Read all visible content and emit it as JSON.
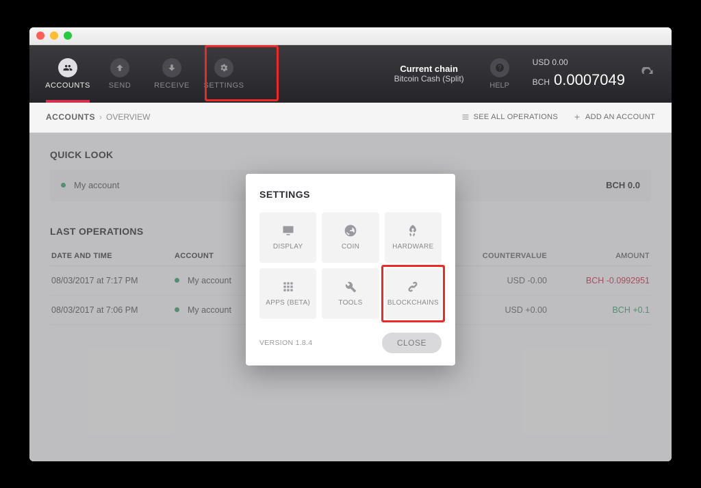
{
  "window": {
    "traffic_lights": [
      "close",
      "minimize",
      "zoom"
    ]
  },
  "header": {
    "nav": [
      {
        "key": "accounts",
        "label": "ACCOUNTS",
        "icon": "users-icon",
        "active": true
      },
      {
        "key": "send",
        "label": "SEND",
        "icon": "arrow-up-icon",
        "active": false
      },
      {
        "key": "receive",
        "label": "RECEIVE",
        "icon": "arrow-down-icon",
        "active": false
      },
      {
        "key": "settings",
        "label": "SETTINGS",
        "icon": "gear-icon",
        "active": false
      }
    ],
    "chain": {
      "title": "Current chain",
      "name": "Bitcoin Cash (Split)"
    },
    "help_label": "HELP",
    "balance_usd_label": "USD",
    "balance_usd_value": "0.00",
    "balance_bch_label": "BCH",
    "balance_bch_value": "0.0007049"
  },
  "subheader": {
    "crumb_root": "ACCOUNTS",
    "crumb_leaf": "OVERVIEW",
    "see_all_label": "SEE ALL OPERATIONS",
    "add_account_label": "ADD AN ACCOUNT"
  },
  "content": {
    "quicklook_title": "QUICK LOOK",
    "account_name": "My account",
    "account_balance": "BCH 0.0",
    "lastops_title": "LAST OPERATIONS",
    "columns": {
      "date": "DATE AND TIME",
      "account": "ACCOUNT",
      "countervalue": "COUNTERVALUE",
      "amount": "AMOUNT"
    },
    "ops": [
      {
        "date": "08/03/2017 at 7:17 PM",
        "account": "My account",
        "cv": "USD -0.00",
        "amount": "BCH -0.0992951",
        "dir": "neg"
      },
      {
        "date": "08/03/2017 at 7:06 PM",
        "account": "My account",
        "cv": "USD +0.00",
        "amount": "BCH +0.1",
        "dir": "pos"
      }
    ]
  },
  "modal": {
    "title": "SETTINGS",
    "tiles": [
      {
        "key": "display",
        "label": "DISPLAY",
        "icon": "monitor-icon"
      },
      {
        "key": "coin",
        "label": "COIN",
        "icon": "globe-icon"
      },
      {
        "key": "hardware",
        "label": "HARDWARE",
        "icon": "rocket-icon"
      },
      {
        "key": "apps",
        "label": "APPS (BETA)",
        "icon": "grid-icon"
      },
      {
        "key": "tools",
        "label": "TOOLS",
        "icon": "wrench-icon"
      },
      {
        "key": "blockchains",
        "label": "BLOCKCHAINS",
        "icon": "chain-icon"
      }
    ],
    "version": "VERSION 1.8.4",
    "close_label": "CLOSE"
  },
  "highlights": {
    "settings_nav": true,
    "blockchains_tile": true
  }
}
